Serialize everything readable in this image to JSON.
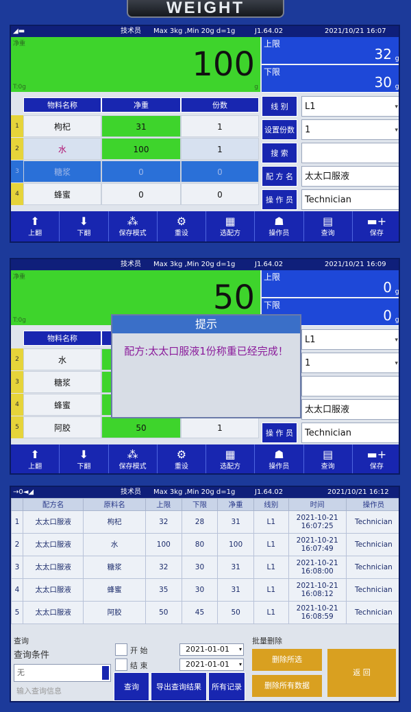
{
  "brand": "WEIGHT",
  "screen1": {
    "status": {
      "icon": "battery-icon",
      "role": "技术员",
      "spec": "Max 3kg ,Min 20g  d=1g",
      "version": "J1.64.02",
      "datetime": "2021/10/21  16:07"
    },
    "display": {
      "tag_top": "净重",
      "tag_zero": "T:0g",
      "unit": "g",
      "value": "100"
    },
    "upper": {
      "label": "上限",
      "value": "32",
      "unit": "g"
    },
    "lower": {
      "label": "下限",
      "value": "30",
      "unit": "g"
    },
    "headers": [
      "物料名称",
      "净重",
      "份数"
    ],
    "rows": [
      {
        "n": "1",
        "name": "枸杞",
        "weight": "31",
        "count": "1"
      },
      {
        "n": "2",
        "name": "水",
        "weight": "100",
        "count": "1"
      },
      {
        "n": "3",
        "name": "糖浆",
        "weight": "0",
        "count": "0"
      },
      {
        "n": "4",
        "name": "蜂蜜",
        "weight": "0",
        "count": "0"
      }
    ],
    "fields": [
      {
        "label": "线  别",
        "value": "L1"
      },
      {
        "label": "设置份数",
        "value": "1"
      },
      {
        "label": "搜  索",
        "value": ""
      },
      {
        "label": "配 方 名",
        "value": "太太口服液"
      },
      {
        "label": "操 作 员",
        "value": "Technician"
      }
    ]
  },
  "toolbar": [
    "上翻",
    "下翻",
    "保存模式",
    "重设",
    "选配方",
    "操作员",
    "查询",
    "保存"
  ],
  "screen2": {
    "status": {
      "role": "技术员",
      "spec": "Max 3kg ,Min 20g  d=1g",
      "version": "J1.64.02",
      "datetime": "2021/10/21  16:09"
    },
    "display": {
      "tag_top": "净重",
      "tag_zero": "T:0g",
      "value": "50"
    },
    "upper": {
      "label": "上限",
      "value": "0",
      "unit": "g"
    },
    "lower": {
      "label": "下限",
      "value": "0",
      "unit": "g"
    },
    "headers": [
      "物料名称"
    ],
    "rows": [
      {
        "n": "2",
        "name": "水"
      },
      {
        "n": "3",
        "name": "糖浆"
      },
      {
        "n": "4",
        "name": "蜂蜜"
      },
      {
        "n": "5",
        "name": "阿胶",
        "weight": "50",
        "count": "1"
      }
    ],
    "fields": [
      {
        "value": "L1"
      },
      {
        "value": "1"
      },
      {
        "value": "太太口服液"
      },
      {
        "label": "操 作 员",
        "value": "Technician"
      }
    ],
    "dialog": {
      "title": "提示",
      "message": "配方:太太口服液1份称重已经完成！"
    }
  },
  "screen3": {
    "status": {
      "icon": "arrow-connect-icon",
      "role": "技术员",
      "spec": "Max 3kg ,Min 20g  d=1g",
      "version": "J1.64.02",
      "datetime": "2021/10/21  16:12"
    },
    "headers": [
      "配方名",
      "原料名",
      "上限",
      "下限",
      "净重",
      "线别",
      "时间",
      "操作员"
    ],
    "records": [
      [
        "1",
        "太太口服液",
        "枸杞",
        "32",
        "28",
        "31",
        "L1",
        "2021-10-21",
        "16:07:25",
        "Technician"
      ],
      [
        "2",
        "太太口服液",
        "水",
        "100",
        "80",
        "100",
        "L1",
        "2021-10-21",
        "16:07:49",
        "Technician"
      ],
      [
        "3",
        "太太口服液",
        "糖浆",
        "32",
        "30",
        "31",
        "L1",
        "2021-10-21",
        "16:08:00",
        "Technician"
      ],
      [
        "4",
        "太太口服液",
        "蜂蜜",
        "35",
        "30",
        "31",
        "L1",
        "2021-10-21",
        "16:08:12",
        "Technician"
      ],
      [
        "5",
        "太太口服液",
        "阿胶",
        "50",
        "45",
        "50",
        "L1",
        "2021-10-21",
        "16:08:59",
        "Technician"
      ]
    ],
    "query": {
      "group": "查询",
      "cond_label": "查询条件",
      "cond_value": "无",
      "placeholder": "输入查询信息",
      "start_label": "开  始",
      "start": "2021-01-01",
      "end_label": "结  束",
      "end": "2021-01-01",
      "btn_query": "查询",
      "btn_export": "导出查询结果",
      "btn_all": "所有记录"
    },
    "batch": {
      "group": "批量删除",
      "del_sel": "删除所选",
      "del_all": "删除所有数据",
      "back": "返  回"
    }
  }
}
